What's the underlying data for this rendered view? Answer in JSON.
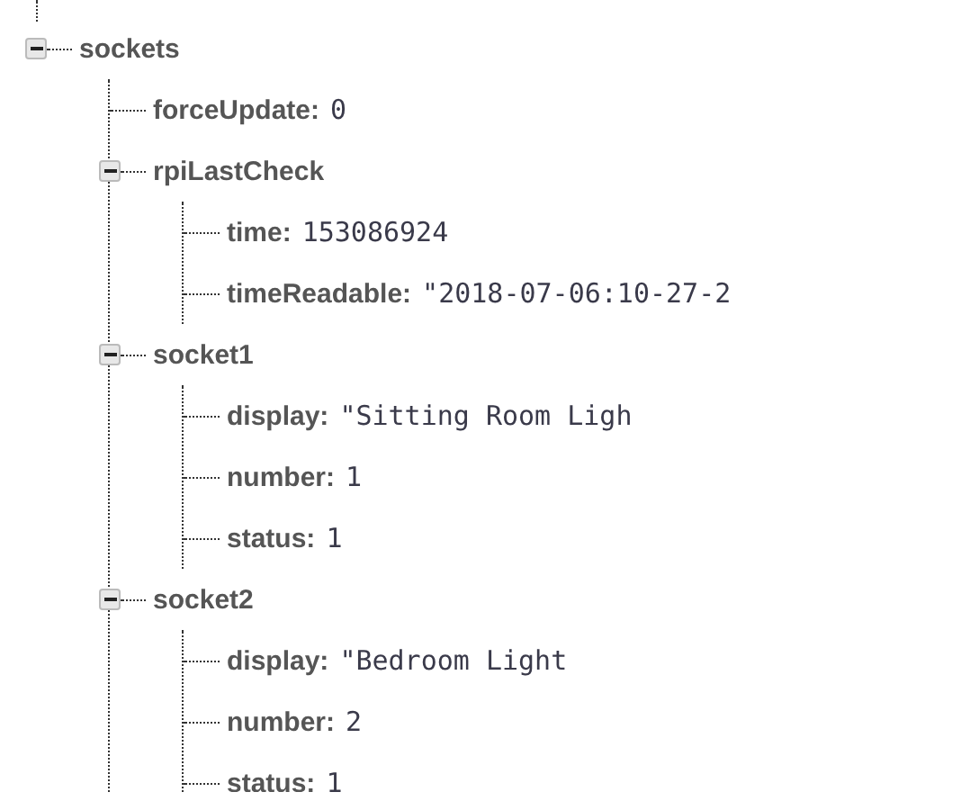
{
  "tree": {
    "key": "sockets",
    "expanded": true,
    "children": [
      {
        "key": "forceUpdate:",
        "value": "0"
      },
      {
        "key": "rpiLastCheck",
        "expanded": true,
        "children": [
          {
            "key": "time:",
            "value": "153086924"
          },
          {
            "key": "timeReadable:",
            "value": "\"2018-07-06:10-27-2"
          }
        ]
      },
      {
        "key": "socket1",
        "expanded": true,
        "children": [
          {
            "key": "display:",
            "value": "\"Sitting Room Ligh"
          },
          {
            "key": "number:",
            "value": "1"
          },
          {
            "key": "status:",
            "value": "1"
          }
        ]
      },
      {
        "key": "socket2",
        "expanded": true,
        "children": [
          {
            "key": "display:",
            "value": "\"Bedroom Light"
          },
          {
            "key": "number:",
            "value": "2"
          },
          {
            "key": "status:",
            "value": "1"
          }
        ]
      }
    ]
  }
}
